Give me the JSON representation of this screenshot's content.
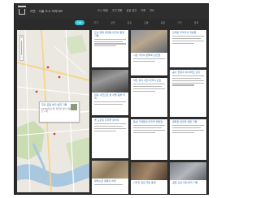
{
  "header": {
    "site_title": "어반 · 서울 도시 아카이브",
    "nav": [
      "도시 재생",
      "주거 변화",
      "공공 공간",
      "기록",
      "지도"
    ]
  },
  "filters": [
    "전체",
    "주거",
    "상업",
    "공공",
    "교통",
    "공원",
    "기타",
    "골목"
  ],
  "map": {
    "zoom_in": "+",
    "zoom_out": "−",
    "popup": {
      "title": "한강 공원 부지 변화 기록",
      "text": "1970년대 이후 하천변 정비 과정을 담은 기록"
    }
  },
  "cards": [
    {
      "title": "도심 골목 재개발 이전의 풍경 기록"
    },
    {
      "title": "시장 거리의 변화와 상인들"
    },
    {
      "title": "오래된 주택가의 지붕들"
    },
    {
      "title": "항공 사진으로 본 서울 동부 지역"
    },
    {
      "title": "하천 정비 이전 마을의 모습"
    },
    {
      "title": "공사 현장과 새 아파트 단지"
    },
    {
      "title": "옛 도로의 흔적을 찾아서"
    },
    {
      "title": "동네 가게들의 마지막 영업일"
    },
    {
      "title": "골목길 담장과 대문 기록"
    },
    {
      "title": "재래시장 골목의 하루"
    },
    {
      "title": "사라진 철길 주변 풍경"
    },
    {
      "title": "공원 조성 이전 부지 기록"
    }
  ]
}
